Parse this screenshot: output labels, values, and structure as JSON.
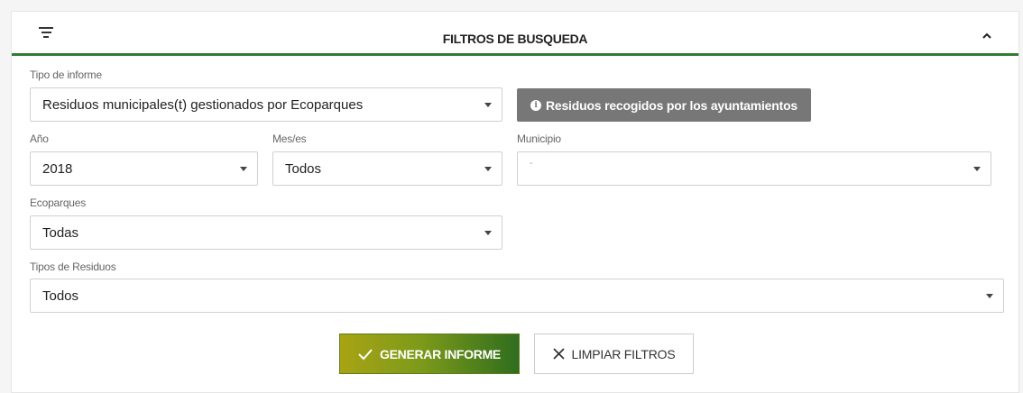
{
  "header": {
    "title": "FILTROS DE BUSQUEDA",
    "filter_icon": "filter-lines-icon",
    "collapse_icon": "chevron-up-icon"
  },
  "tipo_informe": {
    "label": "Tipo de informe",
    "value": "Residuos municipales(t) gestionados por Ecoparques"
  },
  "info_button": {
    "label": "Residuos recogidos por los ayuntamientos",
    "icon": "info-circle-icon"
  },
  "anio": {
    "label": "Año",
    "value": "2018"
  },
  "meses": {
    "label": "Mes/es",
    "value": "Todos"
  },
  "municipio": {
    "label": "Municipio",
    "value": "-"
  },
  "ecoparques": {
    "label": "Ecoparques",
    "value": "Todas"
  },
  "tipos_residuos": {
    "label": "Tipos de Residuos",
    "value": "Todos"
  },
  "actions": {
    "generate_label": "GENERAR INFORME",
    "generate_icon": "check-icon",
    "clear_label": "LIMPIAR FILTROS",
    "clear_icon": "close-icon"
  },
  "colors": {
    "accent_green": "#2e7d32",
    "info_gray": "#777777",
    "generate_gradient_start": "#a8a314",
    "generate_gradient_end": "#2f6d1e"
  }
}
